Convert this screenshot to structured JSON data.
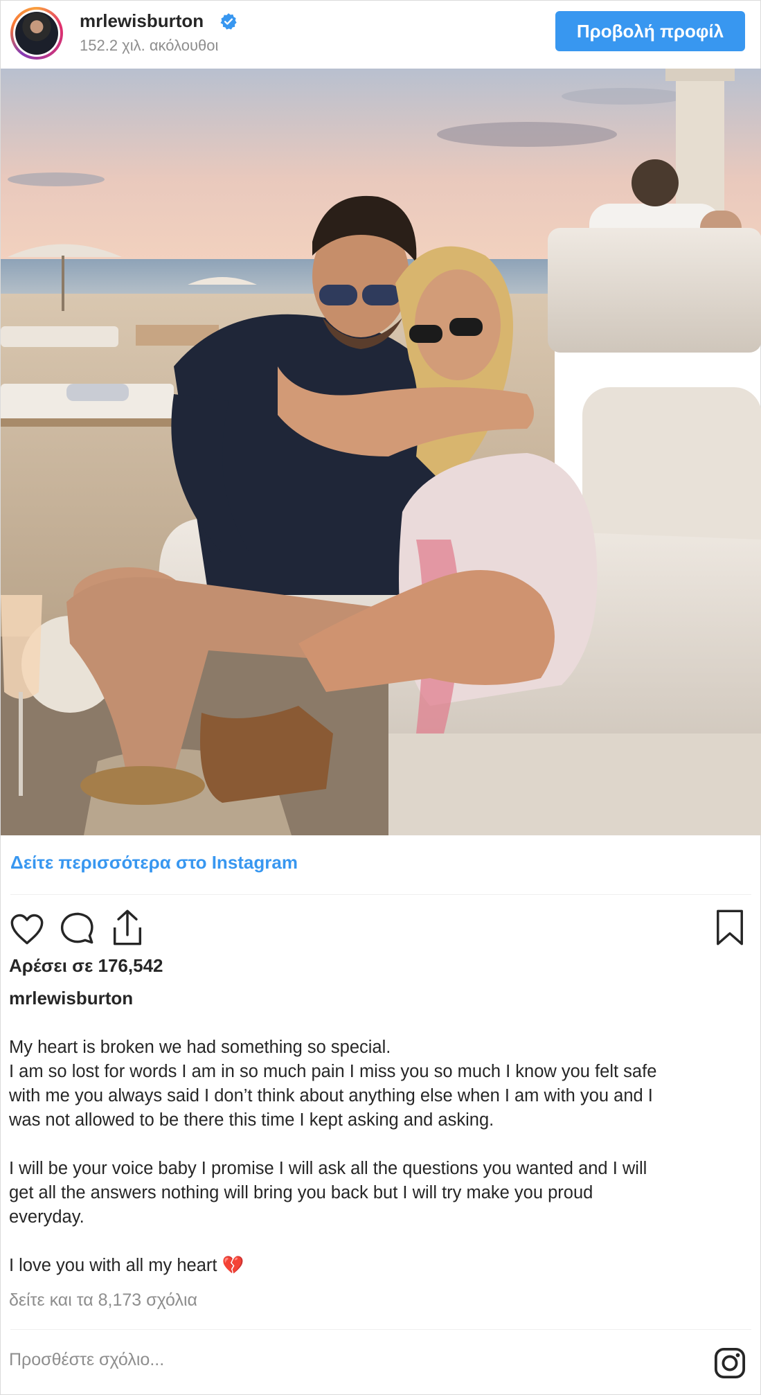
{
  "header": {
    "username": "mrlewisburton",
    "followers": "152.2 χιλ. ακόλουθοι",
    "view_profile_label": "Προβολή προφίλ"
  },
  "photo": {
    "description_icon": "post-photo"
  },
  "see_more": "Δείτε περισσότερα στο Instagram",
  "actions": {
    "like_icon": "heart-icon",
    "comment_icon": "comment-icon",
    "share_icon": "share-icon",
    "save_icon": "bookmark-icon"
  },
  "likes": "Αρέσει σε 176,542",
  "caption": {
    "username": "mrlewisburton",
    "text": "My heart is broken we had something so special.\nI am so lost for words I am in so much pain I miss you so much I know you felt safe\nwith me you always said I don’t think about anything else when I am with you and I\nwas not allowed to be there this time I kept asking and asking.\n\nI will be your voice baby I promise I will ask all the questions you wanted and I will\nget all the answers nothing will bring you back but I will try make you proud\neveryday.\n\nI love you with all my heart 💔"
  },
  "comments_link": "δείτε και τα 8,173 σχόλια",
  "add_comment_placeholder": "Προσθέστε σχόλιο...",
  "colors": {
    "accent": "#3897f0",
    "text": "#262626",
    "muted": "#8e8e8e"
  }
}
